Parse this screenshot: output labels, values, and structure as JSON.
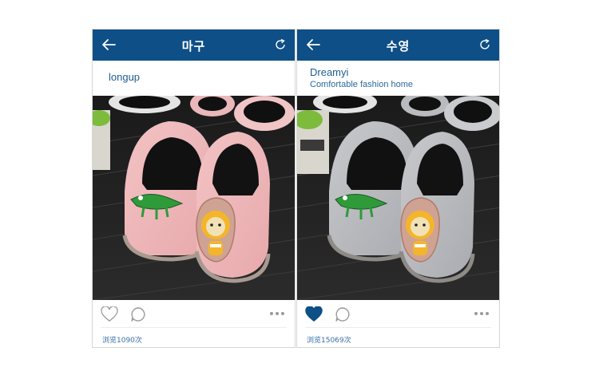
{
  "colors": {
    "header_bg": "#0d4f86",
    "link": "#1e5c92",
    "heart_liked": "#0d4f86"
  },
  "posts": [
    {
      "title": "마구",
      "user_name": "longup",
      "user_sub": "",
      "slipper_color": "pink",
      "liked": false,
      "views_text": "浏览1090次"
    },
    {
      "title": "수영",
      "user_name": "Dreamyi",
      "user_sub": "Comfortable fashion home",
      "slipper_color": "grey",
      "liked": true,
      "views_text": "浏览15069次"
    }
  ],
  "icons": {
    "back": "arrow-left-icon",
    "refresh": "refresh-icon",
    "like": "heart-icon",
    "comment": "comment-bubble-icon",
    "more": "more-dots-icon"
  }
}
